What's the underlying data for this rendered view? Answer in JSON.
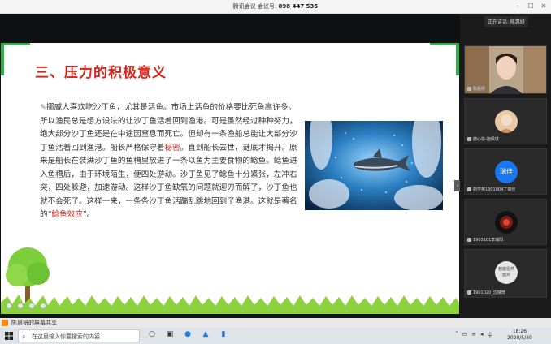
{
  "window": {
    "title_app": "腾讯会议",
    "title_label": "会议号:",
    "meeting_id": "898 447 535"
  },
  "slide": {
    "title": "三、压力的积极意义",
    "para_before": "挪威人喜欢吃沙丁鱼，尤其是活鱼。市场上活鱼的价格要比死鱼高许多。所以渔民总是想方设法的让沙丁鱼活着回到渔港。可是虽然经过种种努力，绝大部分沙丁鱼还是在中途因窒息而死亡。但却有一条渔船总能让大部分沙丁鱼活着回到渔港。船长严格保守着",
    "secret": "秘密",
    "para_middle": "。直到船长去世，谜底才揭开。原来是船长在装满沙丁鱼的鱼槽里放进了一条以鱼为主要食物的鲶鱼。鲶鱼进入鱼槽后，由于环境陌生，便四处游动。沙丁鱼见了鲶鱼十分紧张，左冲右突，四处躲避，加速游动。这样沙丁鱼缺氧的问题就迎刃而解了，沙丁鱼也就不会死了。这样一来，一条条沙丁鱼活蹦乱跳地回到了渔港。这就是著名的“",
    "effect": "鲶鱼效应",
    "para_end": "”。"
  },
  "right_panel": {
    "speaking_label": "正在讲话: 陈惠妍",
    "participants": [
      {
        "name": "陈惠妍"
      },
      {
        "name": "微心协-施佩琪"
      },
      {
        "name": "药学英1901004丁瑞佳",
        "avatar_text": "瑞佳"
      },
      {
        "name": "1903101李曦阳"
      },
      {
        "name": "1901020_沈婧琦",
        "avatar_text": "若能坦然面对"
      }
    ]
  },
  "share_bar": {
    "text": "陈惠妍的屏幕共享"
  },
  "taskbar": {
    "search_placeholder": "在这里输入你要搜索的内容",
    "ime": "中",
    "time": "18:26",
    "date": "2020/5/30"
  },
  "colors": {
    "accent_red": "#d6261c",
    "slide_green": "#2fb24a",
    "avatar_blue": "#1877f2"
  }
}
